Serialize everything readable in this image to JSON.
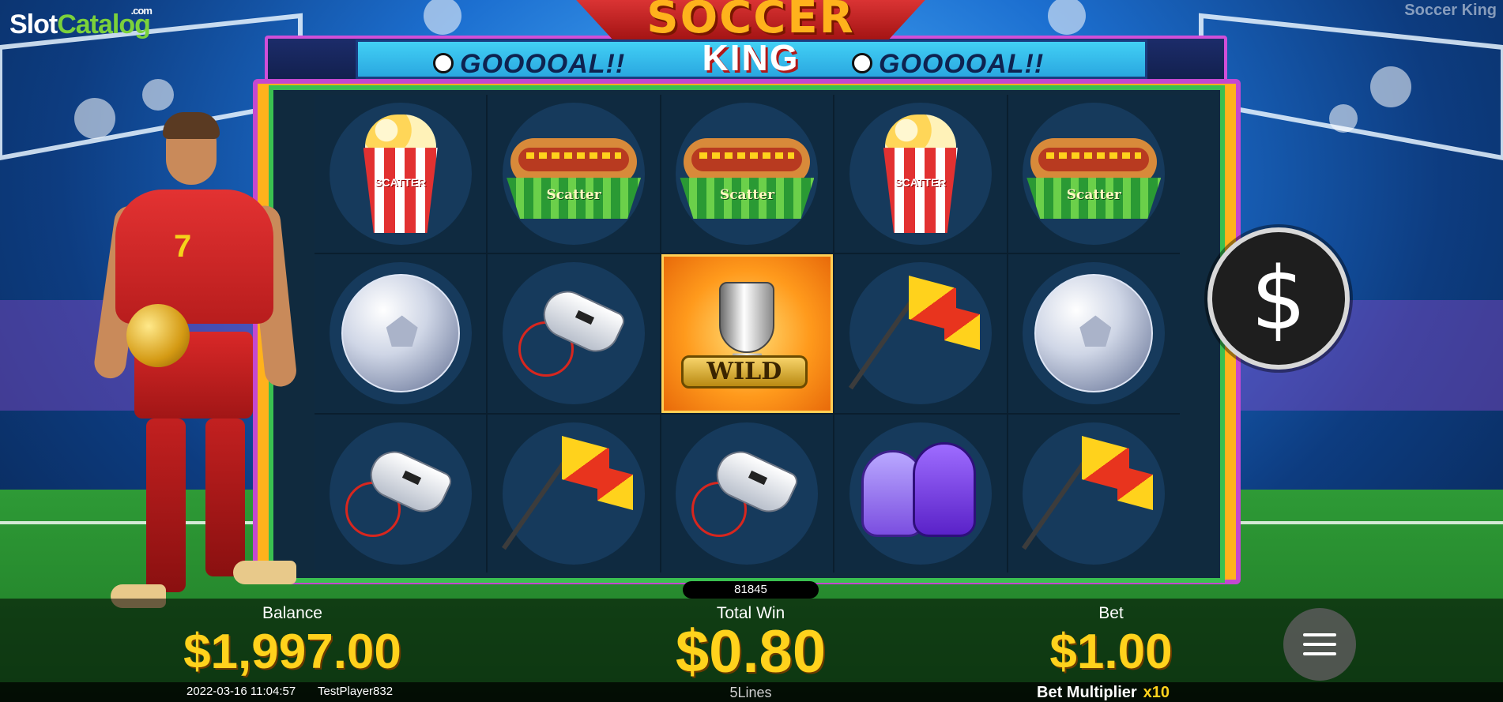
{
  "brand": {
    "slot": "Slot",
    "catalog": "Catalog",
    "com": ".com"
  },
  "game_title_watermark": "Soccer King",
  "logo": {
    "line1": "SOCCER",
    "line2": "KING"
  },
  "marquee": {
    "left": "GOOOOAL!!",
    "right": "GOOOOAL!!"
  },
  "reels": [
    [
      "popcorn-scatter",
      "hotdog-scatter",
      "hotdog-scatter",
      "popcorn-scatter",
      "hotdog-scatter"
    ],
    [
      "soccer-ball",
      "whistle",
      "wild-trophy",
      "corner-flag",
      "soccer-ball"
    ],
    [
      "whistle",
      "corner-flag",
      "whistle",
      "goalkeeper-gloves",
      "corner-flag"
    ]
  ],
  "symbol_labels": {
    "scatter": "SCATTER",
    "hotdog_scatter": "Scatter",
    "wild": "WILD"
  },
  "round_id": "81845",
  "spin_button_symbol": "$",
  "hud": {
    "balance_label": "Balance",
    "balance_value": "$1,997.00",
    "total_win_label": "Total Win",
    "total_win_value": "$0.80",
    "bet_label": "Bet",
    "bet_value": "$1.00",
    "timestamp": "2022-03-16 11:04:57",
    "player": "TestPlayer832",
    "lines": "5Lines",
    "bet_multiplier_label": "Bet Multiplier",
    "bet_multiplier_value": "x10"
  },
  "colors": {
    "accent": "#ffd21c",
    "frame": "#c448d0",
    "reel_bg": "#0f2a40"
  }
}
